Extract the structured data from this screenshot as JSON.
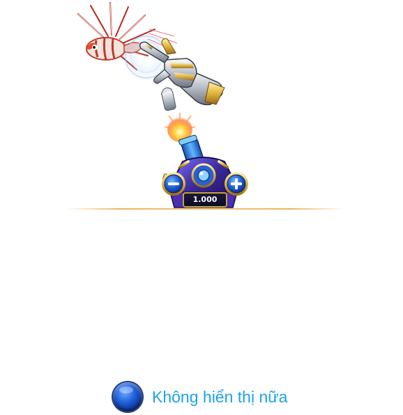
{
  "cannon": {
    "bet_value": "1.000",
    "minus_label": "−",
    "plus_label": "+"
  },
  "dont_show_again": {
    "label": "Không hiển thị nữa"
  },
  "colors": {
    "accent_text": "#1aa3e8",
    "divider": "#f0b25a",
    "cannon_body": "#3a2a9a",
    "gold_trim": "#c9a23a"
  },
  "icons": [
    "lionfish-icon",
    "gauntlet-hand-icon",
    "bullet-icon",
    "cannon-icon",
    "minus-icon",
    "plus-icon",
    "radio-button-icon"
  ]
}
